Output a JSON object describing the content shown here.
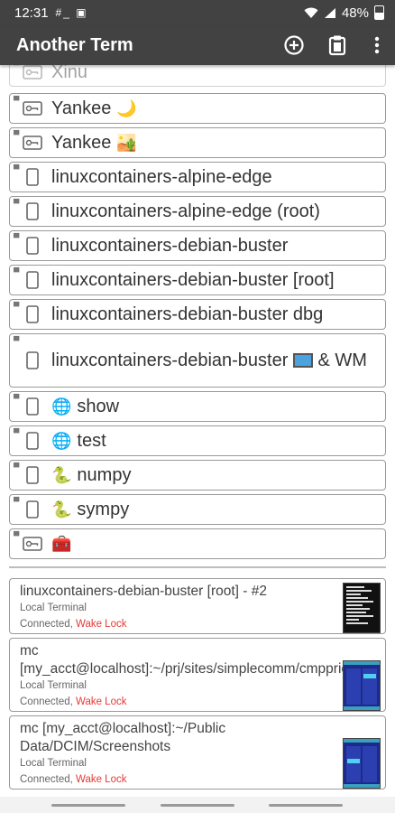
{
  "status": {
    "time": "12:31",
    "notif_icons": "#_ ▣",
    "battery": "48%"
  },
  "appbar": {
    "title": "Another Term",
    "icons": [
      "add-circle-icon",
      "clipboard-icon",
      "overflow-menu-icon"
    ]
  },
  "items": [
    {
      "label": "Xinu",
      "icon": "key-icon",
      "emoji": ""
    },
    {
      "label": "Yankee",
      "icon": "key-icon",
      "emoji": "🌙"
    },
    {
      "label": "Yankee",
      "icon": "key-icon",
      "emoji": "🏜️"
    },
    {
      "label": "linuxcontainers-alpine-edge",
      "icon": "phone-icon",
      "emoji": ""
    },
    {
      "label": "linuxcontainers-alpine-edge (root)",
      "icon": "phone-icon",
      "emoji": ""
    },
    {
      "label": "linuxcontainers-debian-buster",
      "icon": "phone-icon",
      "emoji": ""
    },
    {
      "label": "linuxcontainers-debian-buster [root]",
      "icon": "phone-icon",
      "emoji": ""
    },
    {
      "label": "linuxcontainers-debian-buster dbg",
      "icon": "phone-icon",
      "emoji": ""
    },
    {
      "label": "linuxcontainers-debian-buster",
      "label2": "& WM",
      "icon": "phone-icon",
      "emoji": "🖥️"
    },
    {
      "label": "show",
      "icon": "phone-icon",
      "emoji": "🌐"
    },
    {
      "label": "test",
      "icon": "phone-icon",
      "emoji": "🌐"
    },
    {
      "label": "numpy",
      "icon": "phone-icon",
      "emoji": "🐍"
    },
    {
      "label": "sympy",
      "icon": "phone-icon",
      "emoji": "🐍"
    },
    {
      "label": "",
      "icon": "key-icon",
      "emoji": "🧰"
    }
  ],
  "sessions": [
    {
      "title": "linuxcontainers-debian-buster [root] - #2",
      "type": "Local Terminal",
      "status": "Connected, ",
      "wake": "Wake Lock"
    },
    {
      "title": "mc [my_acct@localhost]:~/prj/sites/simplecomm/cmpprice",
      "type": "Local Terminal",
      "status": "Connected, ",
      "wake": "Wake Lock"
    },
    {
      "title": "mc [my_acct@localhost]:~/Public Data/DCIM/Screenshots",
      "type": "Local Terminal",
      "status": "Connected, ",
      "wake": "Wake Lock"
    }
  ],
  "colors": {
    "bar": "#424242",
    "wake": "#e53935"
  }
}
